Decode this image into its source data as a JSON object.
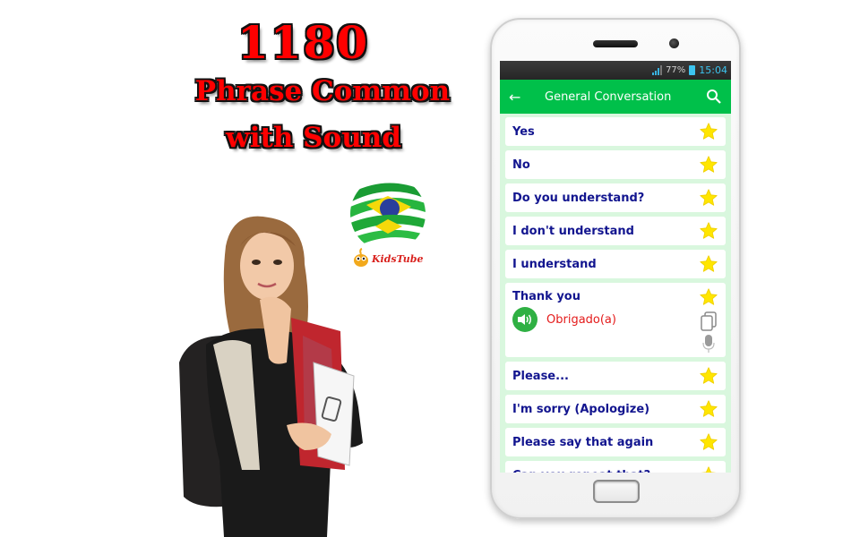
{
  "promo": {
    "line1": "1180",
    "line2": "Phrase Common",
    "line3": "with Sound",
    "logo_text": "KidsTube"
  },
  "status_bar": {
    "battery": "77%",
    "time": "15:04"
  },
  "app_bar": {
    "title": "General Conversation",
    "back_icon": "arrow-left-icon",
    "search_icon": "search-icon"
  },
  "colors": {
    "app_bar": "#00c04a",
    "list_background": "#d9f7de",
    "phrase_text": "#12158f",
    "translation_text": "#e41a1a",
    "star": "#ffe600",
    "sound_button": "#2fb043"
  },
  "phrases": [
    {
      "label": "Yes"
    },
    {
      "label": "No"
    },
    {
      "label": "Do you understand?"
    },
    {
      "label": "I don't understand"
    },
    {
      "label": "I understand"
    },
    {
      "label": "Thank you",
      "translation": "Obrigado(a)",
      "expanded": true
    },
    {
      "label": "Please..."
    },
    {
      "label": "I'm sorry (Apologize)"
    },
    {
      "label": "Please say that again"
    },
    {
      "label": "Can you repeat that?"
    }
  ]
}
